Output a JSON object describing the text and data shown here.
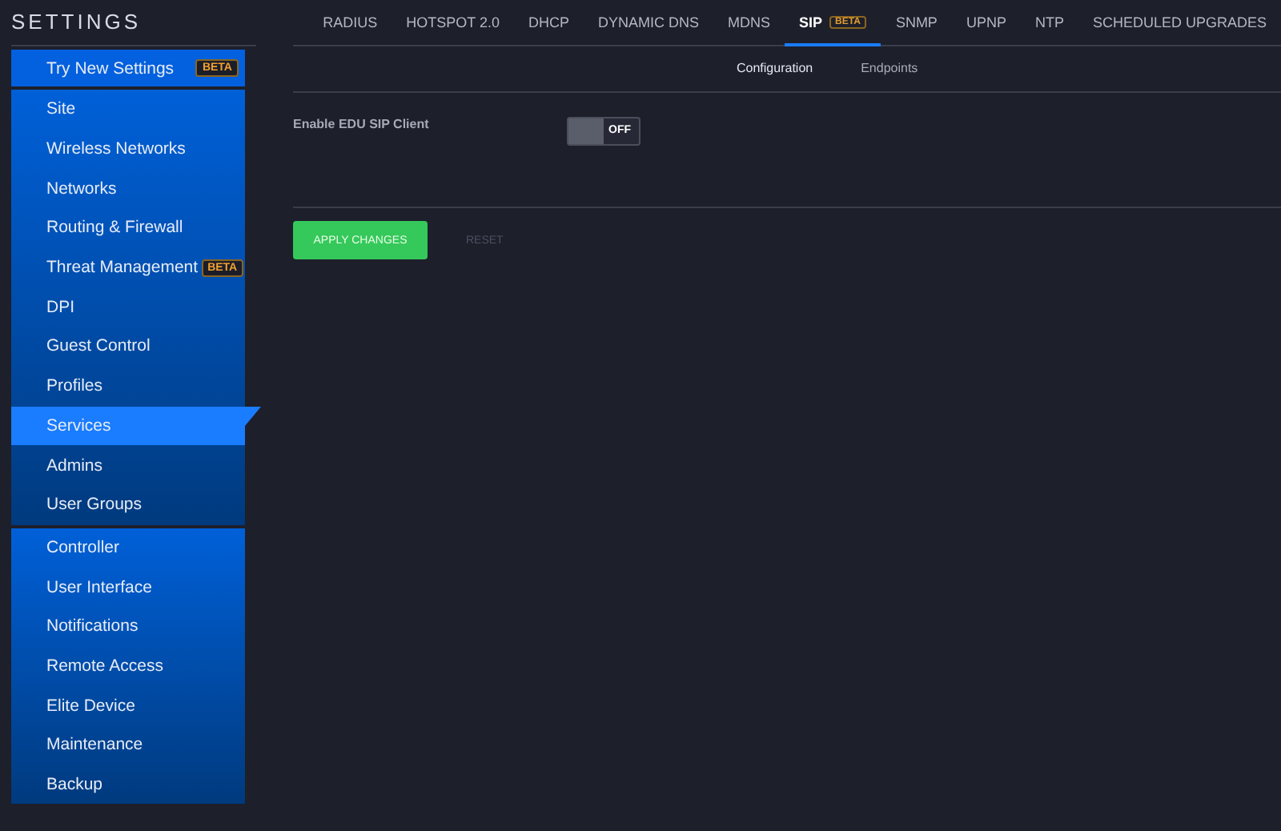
{
  "sidebar": {
    "title": "SETTINGS",
    "groups": [
      {
        "items": [
          {
            "label": "Try New Settings",
            "badge": "BETA",
            "selected": false
          }
        ]
      },
      {
        "items": [
          {
            "label": "Site",
            "selected": false
          },
          {
            "label": "Wireless Networks",
            "selected": false
          },
          {
            "label": "Networks",
            "selected": false
          },
          {
            "label": "Routing & Firewall",
            "selected": false
          },
          {
            "label": "Threat Management",
            "badge": "BETA",
            "selected": false
          },
          {
            "label": "DPI",
            "selected": false
          },
          {
            "label": "Guest Control",
            "selected": false
          },
          {
            "label": "Profiles",
            "selected": false
          },
          {
            "label": "Services",
            "selected": true
          },
          {
            "label": "Admins",
            "selected": false
          },
          {
            "label": "User Groups",
            "selected": false
          }
        ]
      },
      {
        "items": [
          {
            "label": "Controller",
            "selected": false
          },
          {
            "label": "User Interface",
            "selected": false
          },
          {
            "label": "Notifications",
            "selected": false
          },
          {
            "label": "Remote Access",
            "selected": false
          },
          {
            "label": "Elite Device",
            "selected": false
          },
          {
            "label": "Maintenance",
            "selected": false
          },
          {
            "label": "Backup",
            "selected": false
          }
        ]
      }
    ]
  },
  "tabs": [
    {
      "label": "RADIUS",
      "selected": false
    },
    {
      "label": "HOTSPOT 2.0",
      "selected": false
    },
    {
      "label": "DHCP",
      "selected": false
    },
    {
      "label": "DYNAMIC DNS",
      "selected": false
    },
    {
      "label": "MDNS",
      "selected": false
    },
    {
      "label": "SIP",
      "badge": "BETA",
      "selected": true
    },
    {
      "label": "SNMP",
      "selected": false
    },
    {
      "label": "UPNP",
      "selected": false
    },
    {
      "label": "NTP",
      "selected": false
    },
    {
      "label": "SCHEDULED UPGRADES",
      "selected": false
    }
  ],
  "subtabs": [
    {
      "label": "Configuration",
      "selected": true
    },
    {
      "label": "Endpoints",
      "selected": false
    }
  ],
  "settings": [
    {
      "label": "Enable EDU SIP Client",
      "on": false,
      "state_text": "OFF"
    }
  ],
  "buttons": [
    {
      "label": "APPLY CHANGES",
      "kind": "primary"
    },
    {
      "label": "RESET",
      "kind": "secondary"
    }
  ]
}
